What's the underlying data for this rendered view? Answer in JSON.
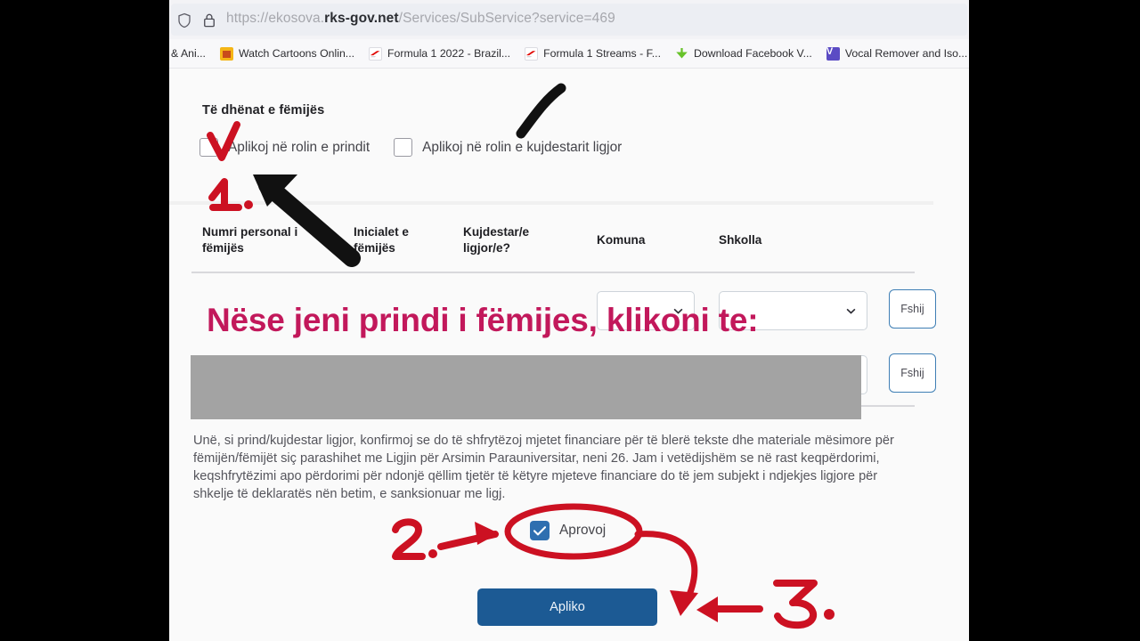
{
  "browser": {
    "url_scheme": "https://ekosova.",
    "url_domain": "rks-gov.net",
    "url_path": "/Services/SubService?service=469",
    "shield_icon": "shield-icon",
    "lock_icon": "lock-icon",
    "bookmarks": [
      {
        "label": "& Ani...",
        "icon": "generic-favicon"
      },
      {
        "label": "Watch Cartoons Onlin...",
        "icon": "watchcartoon-favicon"
      },
      {
        "label": "Formula 1 2022 - Brazil...",
        "icon": "formula1-favicon"
      },
      {
        "label": "Formula 1 Streams - F...",
        "icon": "formula1-favicon"
      },
      {
        "label": "Download Facebook V...",
        "icon": "download-arrow-icon"
      },
      {
        "label": "Vocal Remover and Iso...",
        "icon": "vocalremover-favicon"
      }
    ],
    "bookmarks_overflow_icon": "globe-icon",
    "bookmarks_overflow_label": "·"
  },
  "form": {
    "section_title": "Të dhënat e fëmijës",
    "role_parent_label": "Aplikoj në rolin e prindit",
    "role_guardian_label": "Aplikoj në rolin e kujdestarit ligjor",
    "role_parent_checked": false,
    "role_guardian_checked": false,
    "table": {
      "headers": [
        "Numri personal i fëmijës",
        "Inicialet e fëmijës",
        "Kujdestar/e ligjor/e?",
        "Komuna",
        "Shkolla"
      ],
      "rows": [
        {
          "komuna": "",
          "shkolla": "",
          "delete_label": "Fshij"
        },
        {
          "komuna": "",
          "shkolla": "",
          "delete_label": "Fshij"
        }
      ]
    },
    "declaration": "Unë, si prind/kujdestar ligjor, konfirmoj se do të shfrytëzoj mjetet financiare për të blerë tekste dhe materiale mësimore për fëmijën/fëmijët siç parashihet me Ligjin për Arsimin Parauniversitar, neni 26. Jam i vetëdijshëm se në rast keqpërdorimi, keqshfrytëzimi apo përdorimi për ndonjë qëllim tjetër të këtyre mjeteve financiare do të jem subjekt i ndjekjes ligjore për shkelje të deklaratës nën betim, e sanksionuar me ligj.",
    "approve_label": "Aprovoj",
    "approve_checked": true,
    "submit_label": "Apliko"
  },
  "annotations": {
    "headline_overlay": "Nëse jeni prindi i fëmijes, klikoni te:",
    "step_1": "1.",
    "step_2": "2.",
    "step_3": "3.",
    "color_red": "#cc1122",
    "color_headline": "#c2185b",
    "color_black": "#111111",
    "color_band": "#a3a3a3"
  },
  "colors": {
    "accent_button": "#1c5a94",
    "checkbox_checked": "#2f6fb0",
    "page_bg": "#fafafa",
    "chrome_bg": "#f3f3f6"
  }
}
